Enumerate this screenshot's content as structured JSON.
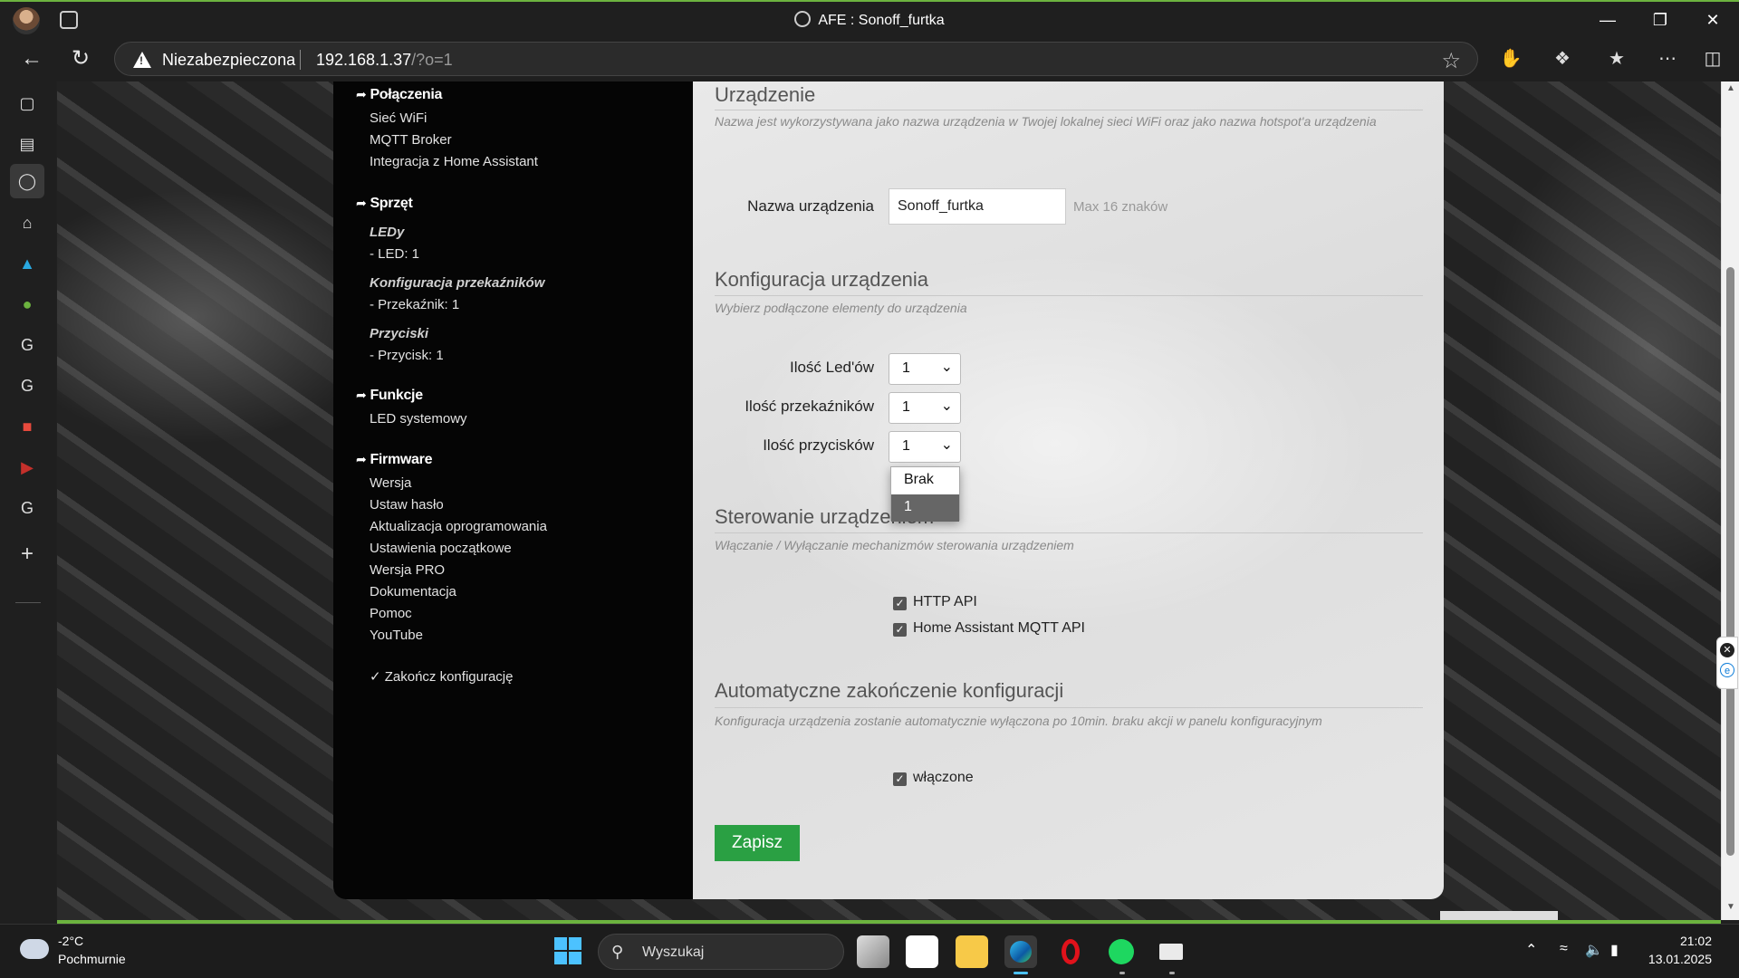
{
  "window": {
    "title": "AFE : Sonoff_furtka",
    "minimize": "—",
    "restore": "❐",
    "close": "✕"
  },
  "addressbar": {
    "security_label": "Niezabezpieczona",
    "url_host": "192.168.1.37",
    "url_path": "/?o=1"
  },
  "menu": {
    "connections": {
      "heading": "Połączenia",
      "items": [
        "Sieć WiFi",
        "MQTT Broker",
        "Integracja z Home Assistant"
      ]
    },
    "hardware": {
      "heading": "Sprzęt",
      "leds_title": "LEDy",
      "leds_item": "- LED: 1",
      "relays_title": "Konfiguracja przekaźników",
      "relays_item": "- Przekaźnik: 1",
      "buttons_title": "Przyciski",
      "buttons_item": "- Przycisk: 1"
    },
    "functions": {
      "heading": "Funkcje",
      "items": [
        "LED systemowy"
      ]
    },
    "firmware": {
      "heading": "Firmware",
      "items": [
        "Wersja",
        "Ustaw hasło",
        "Aktualizacja oprogramowania",
        "Ustawienia początkowe",
        "Wersja PRO",
        "Dokumentacja",
        "Pomoc",
        "YouTube"
      ]
    },
    "finish": "✓ Zakończ konfigurację"
  },
  "device": {
    "title": "Urządzenie",
    "description": "Nazwa jest wykorzystywana jako nazwa urządzenia w Twojej lokalnej sieci WiFi oraz jako nazwa hotspot'a urządzenia",
    "name_label": "Nazwa urządzenia",
    "name_value": "Sonoff_furtka",
    "name_hint": "Max 16 znaków"
  },
  "config": {
    "title": "Konfiguracja urządzenia",
    "description": "Wybierz podłączone elementy do urządzenia",
    "leds_label": "Ilość Led'ów",
    "leds_value": "1",
    "relays_label": "Ilość przekaźników",
    "relays_value": "1",
    "buttons_label": "Ilość przycisków",
    "buttons_value": "1",
    "dropdown_options": [
      "Brak",
      "1"
    ]
  },
  "control": {
    "title": "Sterowanie urządzeniem",
    "description": "Włączanie / Wyłączanie mechanizmów sterowania urządzeniem",
    "http_api": "HTTP API",
    "ha_mqtt_api": "Home Assistant MQTT API"
  },
  "auto_finish": {
    "title": "Automatyczne zakończenie konfiguracji",
    "description": "Konfiguracja urządzenia zostanie automatycznie wyłączona po 10min. braku akcji w panelu konfiguracyjnym",
    "enabled_label": "włączone"
  },
  "save_label": "Zapisz",
  "taskbar": {
    "temperature": "-2°C",
    "condition": "Pochmurnie",
    "search_placeholder": "Wyszukaj",
    "time": "21:02",
    "date": "13.01.2025"
  },
  "colors": {
    "accent_green": "#2aa043",
    "window_border": "#6cb33f"
  }
}
